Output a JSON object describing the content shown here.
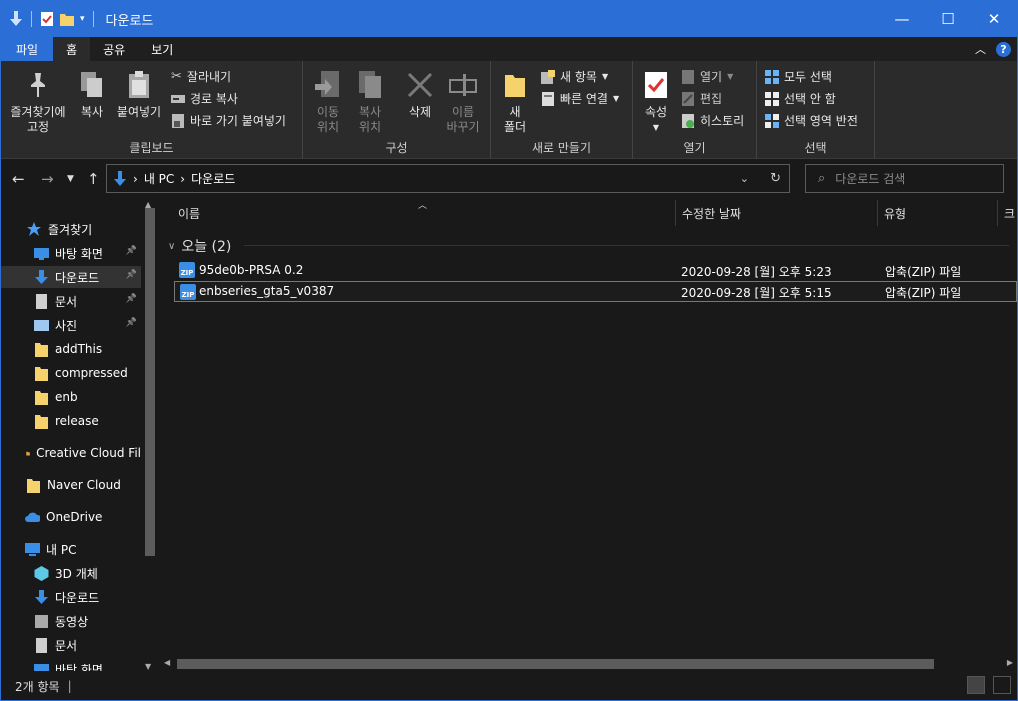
{
  "window": {
    "title": "다운로드",
    "minimize": "—",
    "maximize": "☐",
    "close": "✕"
  },
  "tabs": [
    "파일",
    "홈",
    "공유",
    "보기"
  ],
  "ribbon": {
    "clipboard": {
      "label": "클립보드",
      "pin": "즐겨찾기에\n고정",
      "copy": "복사",
      "paste": "붙여넣기",
      "cut": "잘라내기",
      "copy_path": "경로 복사",
      "paste_shortcut": "바로 가기 붙여넣기"
    },
    "organize": {
      "label": "구성",
      "move_to": "이동\n위치",
      "copy_to": "복사\n위치",
      "delete": "삭제",
      "rename": "이름\n바꾸기"
    },
    "new": {
      "label": "새로 만들기",
      "new_folder": "새\n폴더",
      "new_item": "새 항목",
      "easy_access": "빠른 연결"
    },
    "open": {
      "label": "열기",
      "properties": "속성",
      "open": "열기",
      "edit": "편집",
      "history": "히스토리"
    },
    "select": {
      "label": "선택",
      "select_all": "모두 선택",
      "select_none": "선택 안 함",
      "invert": "선택 영역 반전"
    }
  },
  "address": {
    "path": [
      "내 PC",
      "다운로드"
    ],
    "search_placeholder": "다운로드 검색"
  },
  "sidebar": {
    "items": [
      {
        "label": "즐겨찾기",
        "icon": "star-icon",
        "color": "#4a9ff5"
      },
      {
        "label": "바탕 화면",
        "icon": "desktop-icon",
        "color": "#3a8ee6",
        "pinned": true
      },
      {
        "label": "다운로드",
        "icon": "download-icon",
        "color": "#3a8ee6",
        "pinned": true
      },
      {
        "label": "문서",
        "icon": "document-icon",
        "color": "#cfcfcf",
        "pinned": true
      },
      {
        "label": "사진",
        "icon": "picture-icon",
        "color": "#9ec8f0",
        "pinned": true
      },
      {
        "label": "addThis",
        "icon": "folder-icon",
        "color": "#f5d26b"
      },
      {
        "label": "compressed",
        "icon": "folder-icon",
        "color": "#f5d26b"
      },
      {
        "label": "enb",
        "icon": "folder-icon",
        "color": "#f5d26b"
      },
      {
        "label": "release",
        "icon": "folder-icon",
        "color": "#f5d26b"
      },
      {
        "label": "Creative Cloud Fil",
        "icon": "creative-cloud-icon",
        "color": "#e8a33a"
      },
      {
        "label": "Naver Cloud",
        "icon": "folder-icon",
        "color": "#f5d26b"
      },
      {
        "label": "OneDrive",
        "icon": "cloud-icon",
        "color": "#3a8ee6"
      },
      {
        "label": "내 PC",
        "icon": "pc-icon",
        "color": "#3a8ee6"
      },
      {
        "label": "3D 개체",
        "icon": "cube-icon",
        "color": "#5ec8e8"
      },
      {
        "label": "다운로드",
        "icon": "download-icon",
        "color": "#3a8ee6"
      },
      {
        "label": "동영상",
        "icon": "video-icon",
        "color": "#aaaaaa"
      },
      {
        "label": "문서",
        "icon": "document-icon",
        "color": "#cfcfcf"
      },
      {
        "label": "바탕 화면",
        "icon": "desktop-icon",
        "color": "#3a8ee6"
      }
    ]
  },
  "columns": [
    "이름",
    "수정한 날짜",
    "유형",
    "크"
  ],
  "group": {
    "title": "오늘 (2)"
  },
  "files": [
    {
      "name": "95de0b-PRSA 0.2",
      "date": "2020-09-28 [월] 오후 5:23",
      "type": "압축(ZIP) 파일"
    },
    {
      "name": "enbseries_gta5_v0387",
      "date": "2020-09-28 [월] 오후 5:15",
      "type": "압축(ZIP) 파일"
    }
  ],
  "status": {
    "count": "2개 항목",
    "sep": "|"
  }
}
